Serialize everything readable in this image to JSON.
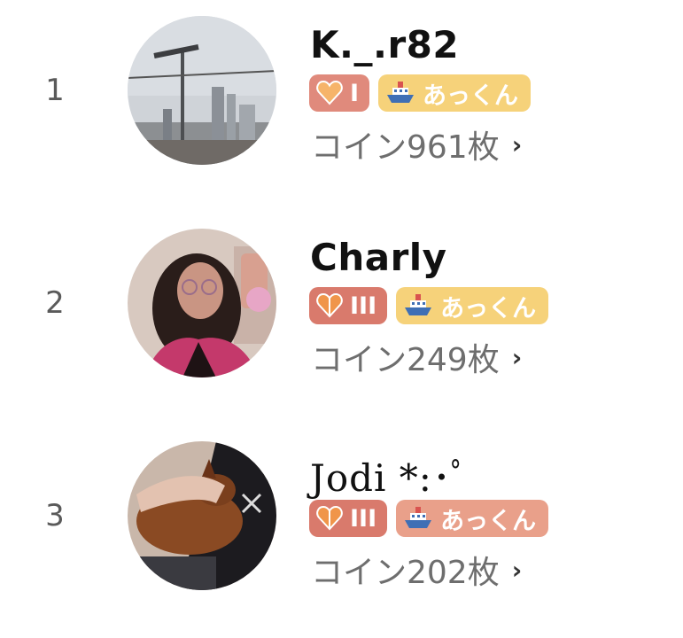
{
  "ranking": [
    {
      "rank": "1",
      "name": "K._.r82",
      "level_label": "I",
      "fan_label": "あっくん",
      "coins_label": "コイン961枚",
      "chevron": "›"
    },
    {
      "rank": "2",
      "name": "Charly",
      "level_label": "III",
      "fan_label": "あっくん",
      "coins_label": "コイン249枚",
      "chevron": "›"
    },
    {
      "rank": "3",
      "name": "Jodi *:･ﾟ",
      "level_label": "III",
      "fan_label": "あっくん",
      "coins_label": "コイン202枚",
      "chevron": "›"
    }
  ],
  "colors": {
    "level_badge": "#e08a7c",
    "fan_badge_yellow": "#f6d27a",
    "fan_badge_salmon": "#e9a08a",
    "coins_text": "#6e6e6e",
    "rank_text": "#5a5a5a"
  },
  "icons": {
    "level": "heart-icon",
    "fan": "ship-icon",
    "chevron": "chevron-right-icon"
  }
}
